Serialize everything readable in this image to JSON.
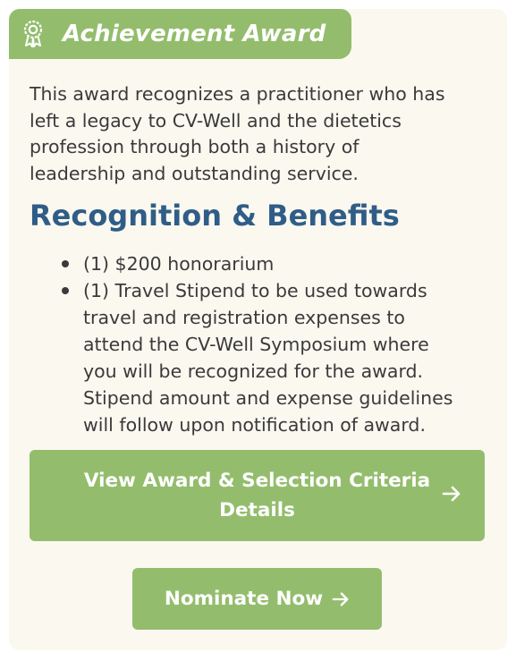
{
  "award": {
    "icon": "award-ribbon-icon",
    "title": "Achievement Award"
  },
  "description": {
    "line1": "This award recognizes a practitioner who has",
    "line2": "left a legacy to CV-Well and the dietetics",
    "line3": "profession through both a history of",
    "line4": "leadership and outstanding service."
  },
  "benefits": {
    "heading": "Recognition & Benefits",
    "items": [
      {
        "lines": [
          "(1) $200 honorarium"
        ]
      },
      {
        "lines": [
          "(1) Travel Stipend to be used towards",
          "travel and registration expenses to",
          "attend the CV-Well Symposium where",
          "you will be recognized for the award.",
          "Stipend amount and expense guidelines",
          "will follow upon notification of award."
        ]
      }
    ]
  },
  "buttons": {
    "criteria": {
      "line1": "View Award & Selection Criteria",
      "line2": "Details",
      "icon": "arrow-right-icon"
    },
    "nominate": {
      "label": "Nominate Now",
      "icon": "arrow-right-icon"
    }
  },
  "colors": {
    "accent_green": "#93bd6c",
    "heading_blue": "#2f5d87",
    "card_background": "#fbf8f0",
    "body_text": "#3a3a3a"
  }
}
